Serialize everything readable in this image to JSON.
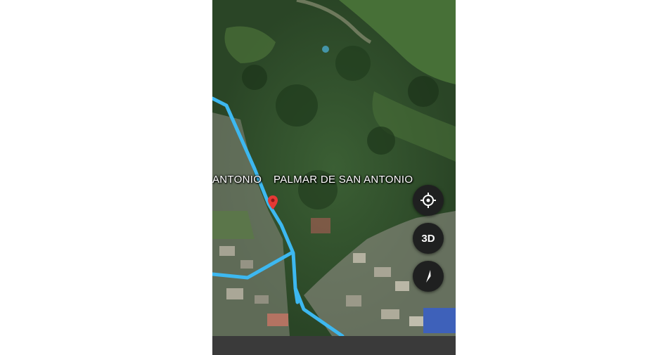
{
  "map": {
    "labels": {
      "left_fragment": "ANTONIO",
      "main": "PALMAR DE SAN ANTONIO"
    },
    "controls": {
      "three_d_label": "3D"
    },
    "icons": [
      "location-pin-icon",
      "my-location-icon",
      "compass-icon"
    ],
    "colors": {
      "route": "#3db8f0",
      "pin": "#e53935",
      "button_bg": "#1f2020"
    }
  }
}
